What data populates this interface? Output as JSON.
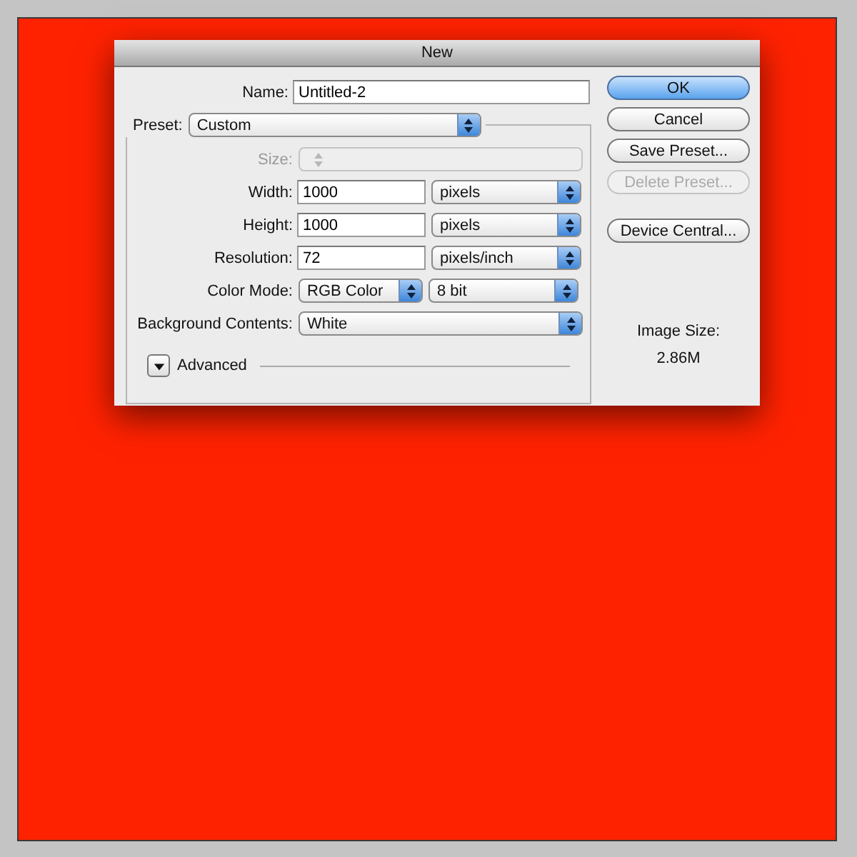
{
  "window": {
    "title": "New"
  },
  "name": {
    "label": "Name:",
    "value": "Untitled-2"
  },
  "preset": {
    "label": "Preset:",
    "value": "Custom"
  },
  "rows": [
    {
      "label": "Size:",
      "disabled": true,
      "fields": [
        {
          "kind": "wide_popup",
          "disabled": true
        }
      ]
    },
    {
      "label": "Width:",
      "disabled": false,
      "fields": [
        {
          "kind": "text",
          "value": "1000"
        },
        {
          "kind": "popup",
          "value": "pixels",
          "disabled": false
        }
      ]
    },
    {
      "label": "Height:",
      "disabled": false,
      "fields": [
        {
          "kind": "text",
          "value": "1000"
        },
        {
          "kind": "popup",
          "value": "pixels",
          "disabled": false
        }
      ]
    },
    {
      "label": "Resolution:",
      "disabled": false,
      "fields": [
        {
          "kind": "text",
          "value": "72"
        },
        {
          "kind": "popup",
          "value": "pixels/inch",
          "disabled": false
        }
      ]
    },
    {
      "label": "Color Mode:",
      "disabled": false,
      "fields": [
        {
          "kind": "popup",
          "value": "RGB Color",
          "disabled": false
        },
        {
          "kind": "popup",
          "value": "8 bit",
          "disabled": false
        }
      ]
    },
    {
      "label": "Background Contents:",
      "disabled": false,
      "fields": [
        {
          "kind": "wide_popup",
          "value": "White",
          "disabled": false
        }
      ]
    }
  ],
  "advanced": {
    "label": "Advanced",
    "expanded": false
  },
  "buttons": [
    {
      "label": "OK",
      "default": true,
      "disabled": false
    },
    {
      "label": "Cancel",
      "default": false,
      "disabled": false
    },
    {
      "label": "Save Preset...",
      "default": false,
      "disabled": false
    },
    {
      "label": "Delete Preset...",
      "default": false,
      "disabled": true
    },
    {
      "label": "Device Central...",
      "default": false,
      "disabled": false
    }
  ],
  "image_size": {
    "label": "Image Size:",
    "value": "2.86M"
  }
}
